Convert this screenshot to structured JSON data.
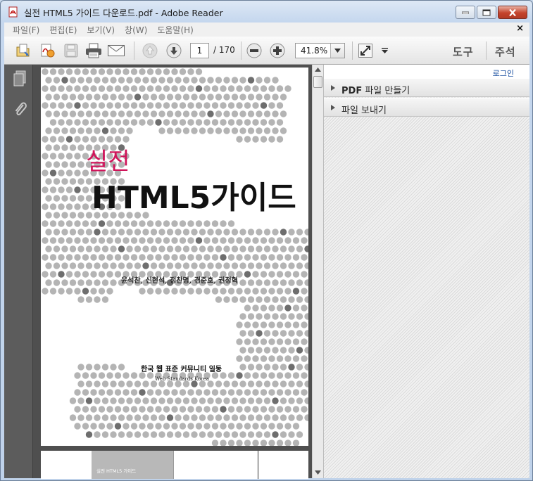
{
  "window": {
    "title": "실전 HTML5 가이드 다운로드.pdf - Adobe Reader"
  },
  "menu": {
    "items": [
      "파일(F)",
      "편집(E)",
      "보기(V)",
      "창(W)",
      "도움말(H)"
    ],
    "close_glyph": "×"
  },
  "toolbar": {
    "page_current": "1",
    "page_total": "/ 170",
    "zoom": "41.8%",
    "tools_label": "도구",
    "comment_label": "주석"
  },
  "right_panel": {
    "login": "로그인",
    "sections": [
      {
        "bold": "PDF",
        "rest": " 파일 만들기"
      },
      {
        "bold": "",
        "rest": "파일 보내기"
      }
    ]
  },
  "document": {
    "title_top": "실전",
    "title_main": "HTML5가이드",
    "authors": "윤석찬, 신현석, 정찬명, 경준호, 권정혁",
    "publisher": "한국 웹 표준 커뮤니티 일동",
    "publisher_en": "Web Standards Korea",
    "page2_header": "실전 HTML5 가이드"
  },
  "colors": {
    "title_accent": "#d0145a",
    "dot_light": "#b4b4b4",
    "dot_dark": "#6e6e6e",
    "panel_dark": "#5c5c5c"
  }
}
